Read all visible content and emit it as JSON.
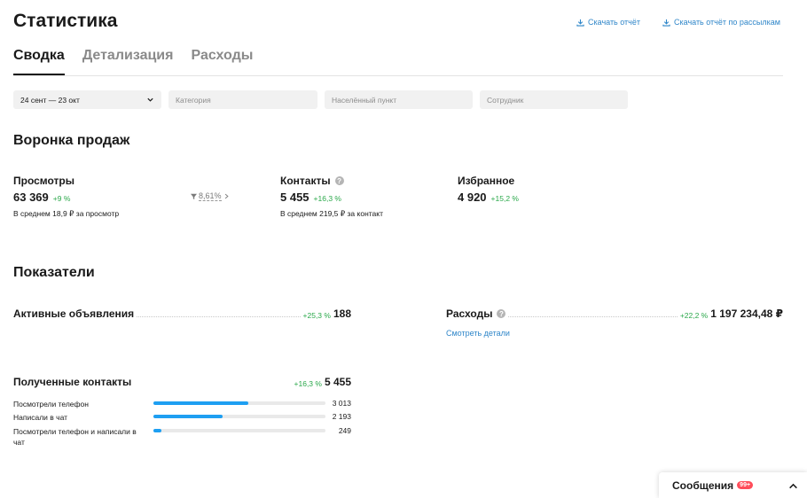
{
  "header": {
    "title": "Статистика",
    "download_report": "Скачать отчёт",
    "download_mailing_report": "Скачать отчёт по рассылкам"
  },
  "tabs": [
    {
      "label": "Сводка",
      "active": true
    },
    {
      "label": "Детализация",
      "active": false
    },
    {
      "label": "Расходы",
      "active": false
    }
  ],
  "filters": {
    "period": "24 сент — 23 окт",
    "category_placeholder": "Категория",
    "city_placeholder": "Населённый пункт",
    "employee_placeholder": "Сотрудник"
  },
  "funnel": {
    "title": "Воронка продаж",
    "views": {
      "label": "Просмотры",
      "value": "63 369",
      "change": "+9 %",
      "sub": "В среднем 18,9 ₽ за просмотр"
    },
    "conversion": "8,61%",
    "contacts": {
      "label": "Контакты",
      "value": "5 455",
      "change": "+16,3 %",
      "sub": "В среднем 219,5 ₽ за контакт"
    },
    "favorites": {
      "label": "Избранное",
      "value": "4 920",
      "change": "+15,2 %"
    }
  },
  "indicators": {
    "title": "Показатели",
    "active_ads": {
      "label": "Активные объявления",
      "change": "+25,3 %",
      "value": "188"
    },
    "expenses": {
      "label": "Расходы",
      "change": "+22,2 %",
      "value": "1 197 234,48 ₽",
      "details_link": "Смотреть детали"
    },
    "contacts": {
      "label": "Полученные контакты",
      "change": "+16,3 %",
      "value": "5 455",
      "breakdown": [
        {
          "label": "Посмотрели телефон",
          "value": "3 013",
          "share": 0.552
        },
        {
          "label": "Написали в чат",
          "value": "2 193",
          "share": 0.402
        },
        {
          "label": "Посмотрели телефон и написали в чат",
          "value": "249",
          "share": 0.046
        }
      ]
    }
  },
  "messages": {
    "label": "Сообщения",
    "badge": "99+"
  },
  "colors": {
    "accent": "#2f86c9",
    "positive": "#2aa84a",
    "bar": "#1e9ff2",
    "badge": "#ff4d5a"
  }
}
